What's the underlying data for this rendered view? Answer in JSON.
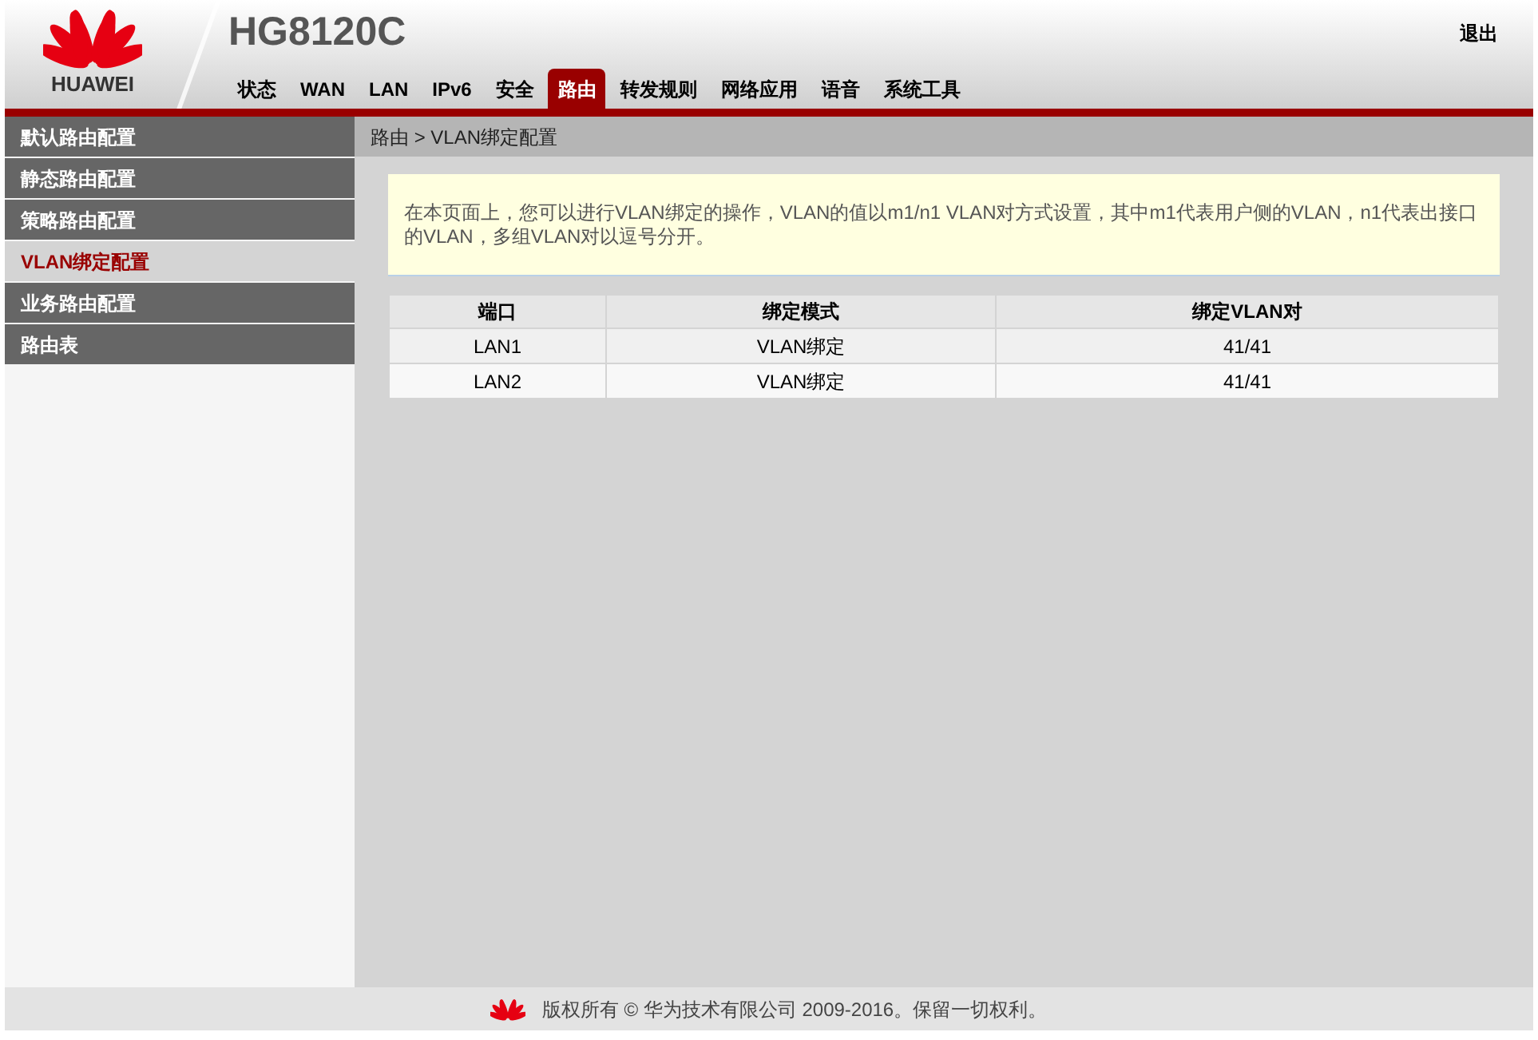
{
  "header": {
    "brand": "HUAWEI",
    "model": "HG8120C",
    "logout": "退出"
  },
  "nav": [
    {
      "label": "状态",
      "selected": false
    },
    {
      "label": "WAN",
      "selected": false
    },
    {
      "label": "LAN",
      "selected": false
    },
    {
      "label": "IPv6",
      "selected": false
    },
    {
      "label": "安全",
      "selected": false
    },
    {
      "label": "路由",
      "selected": true
    },
    {
      "label": "转发规则",
      "selected": false
    },
    {
      "label": "网络应用",
      "selected": false
    },
    {
      "label": "语音",
      "selected": false
    },
    {
      "label": "系统工具",
      "selected": false
    }
  ],
  "sidebar": {
    "items": [
      {
        "label": "默认路由配置",
        "selected": false
      },
      {
        "label": "静态路由配置",
        "selected": false
      },
      {
        "label": "策略路由配置",
        "selected": false
      },
      {
        "label": "VLAN绑定配置",
        "selected": true
      },
      {
        "label": "业务路由配置",
        "selected": false
      },
      {
        "label": "路由表",
        "selected": false
      }
    ]
  },
  "breadcrumb": "路由 > VLAN绑定配置",
  "notice": "在本页面上，您可以进行VLAN绑定的操作，VLAN的值以m1/n1 VLAN对方式设置，其中m1代表用户侧的VLAN，n1代表出接口的VLAN，多组VLAN对以逗号分开。",
  "table": {
    "columns": [
      "端口",
      "绑定模式",
      "绑定VLAN对"
    ],
    "rows": [
      [
        "LAN1",
        "VLAN绑定",
        "41/41"
      ],
      [
        "LAN2",
        "VLAN绑定",
        "41/41"
      ]
    ]
  },
  "footer": "版权所有 © 华为技术有限公司 2009-2016。保留一切权利。"
}
